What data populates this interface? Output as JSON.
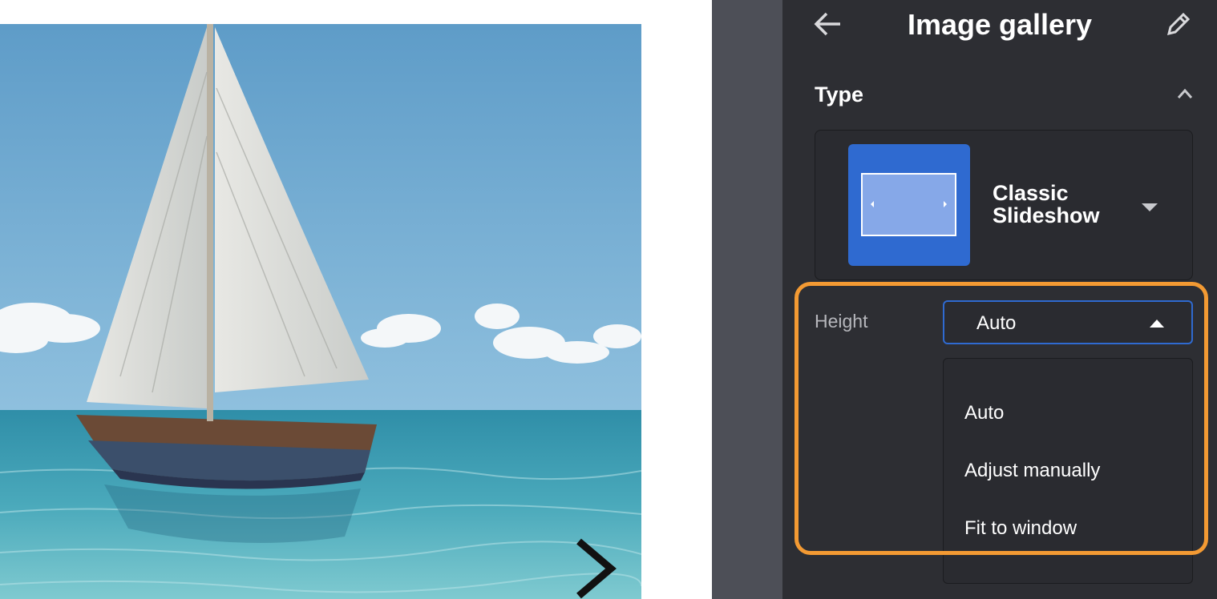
{
  "panel": {
    "title": "Image gallery",
    "back_icon": "arrow-left-icon",
    "edit_icon": "pencil-icon"
  },
  "type_section": {
    "heading": "Type",
    "collapse_icon": "chevron-up-icon",
    "selected_type": "Classic Slideshow",
    "dropdown_icon": "caret-down-icon",
    "thumbnail_icon": "slideshow-icon"
  },
  "height": {
    "label": "Height",
    "selected": "Auto",
    "options": [
      "Auto",
      "Adjust manually",
      "Fit to window"
    ]
  },
  "preview": {
    "next_icon": "chevron-right-icon"
  },
  "colors": {
    "panel_bg": "#2d2e33",
    "gutter_bg": "#4d4f57",
    "accent_blue": "#2f6ad0",
    "highlight_orange": "#f39a33"
  }
}
